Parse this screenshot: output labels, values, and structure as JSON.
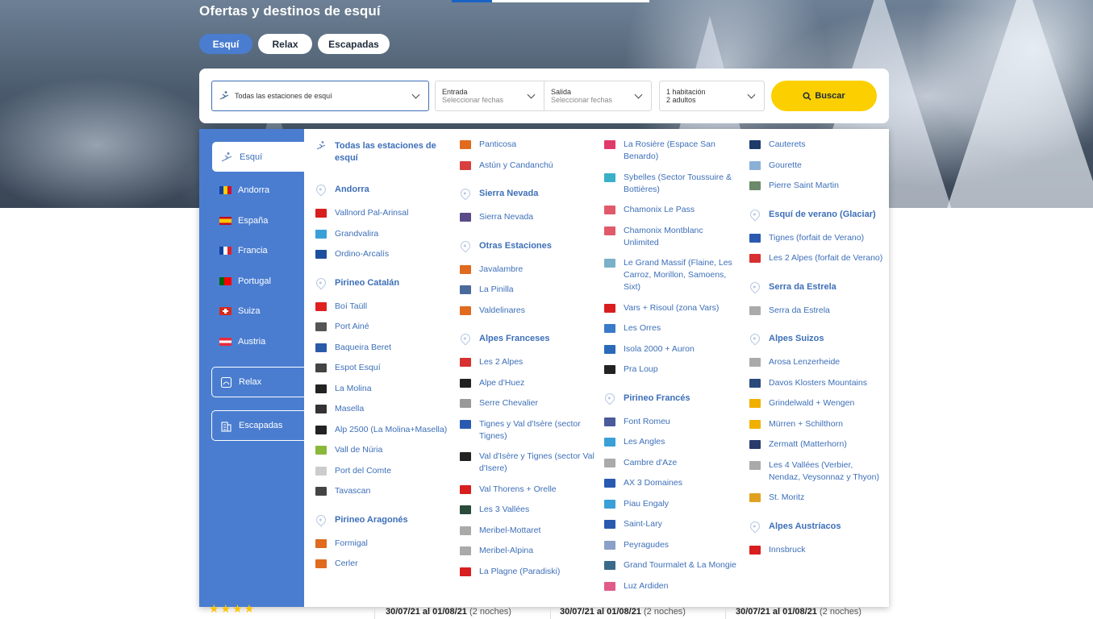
{
  "page": {
    "title": "Ofertas y destinos de esquí"
  },
  "tabs": [
    {
      "label": "Esquí",
      "active": true
    },
    {
      "label": "Relax",
      "active": false
    },
    {
      "label": "Escapadas",
      "active": false
    }
  ],
  "search": {
    "destination": "Todas las estaciones de esquí",
    "checkin_label": "Entrada",
    "checkin_placeholder": "Seleccionar fechas",
    "checkout_label": "Salida",
    "checkout_placeholder": "Seleccionar fechas",
    "rooms": "1 habitación",
    "guests": "2 adultos",
    "button": "Buscar"
  },
  "sidebar": {
    "ski_label": "Esquí",
    "countries": [
      "Andorra",
      "España",
      "Francia",
      "Portugal",
      "Suiza",
      "Austria"
    ],
    "relax_label": "Relax",
    "escapadas_label": "Escapadas"
  },
  "colors": {
    "brand_blue": "#4a7dd0",
    "link_blue": "#3d6fb8",
    "accent_yellow": "#fcd000"
  },
  "columns": [
    {
      "blocks": [
        {
          "type": "head",
          "label": "Todas las estaciones de esquí",
          "icon": "skier-icon"
        },
        {
          "type": "head",
          "label": "Andorra"
        },
        {
          "type": "item",
          "label": "Vallnord Pal-Arinsal",
          "color": "#d81e1e"
        },
        {
          "type": "item",
          "label": "Grandvalira",
          "color": "#3aa0d8"
        },
        {
          "type": "item",
          "label": "Ordino-Arcalís",
          "color": "#1d4fa0"
        },
        {
          "type": "head",
          "label": "Pirineo Catalán"
        },
        {
          "type": "item",
          "label": "Boí Taüll",
          "color": "#e02020"
        },
        {
          "type": "item",
          "label": "Port Ainé",
          "color": "#555555"
        },
        {
          "type": "item",
          "label": "Baqueira Beret",
          "color": "#2a5aa8"
        },
        {
          "type": "item",
          "label": "Espot Esquí",
          "color": "#444444"
        },
        {
          "type": "item",
          "label": "La Molina",
          "color": "#222222"
        },
        {
          "type": "item",
          "label": "Masella",
          "color": "#333333"
        },
        {
          "type": "item",
          "label": "Alp 2500 (La Molina+Masella)",
          "color": "#222222"
        },
        {
          "type": "item",
          "label": "Vall de Núria",
          "color": "#8ab83a"
        },
        {
          "type": "item",
          "label": "Port del Comte",
          "color": "#cccccc"
        },
        {
          "type": "item",
          "label": "Tavascan",
          "color": "#444444"
        },
        {
          "type": "head",
          "label": "Pirineo Aragonés"
        },
        {
          "type": "item",
          "label": "Formigal",
          "color": "#e06a1e"
        },
        {
          "type": "item",
          "label": "Cerler",
          "color": "#e06a1e"
        }
      ]
    },
    {
      "blocks": [
        {
          "type": "item",
          "label": "Panticosa",
          "color": "#e06a1e"
        },
        {
          "type": "item",
          "label": "Astún y Candanchú",
          "color": "#d84040"
        },
        {
          "type": "head",
          "label": "Sierra Nevada"
        },
        {
          "type": "item",
          "label": "Sierra Nevada",
          "color": "#5a4a8a"
        },
        {
          "type": "head",
          "label": "Otras Estaciones"
        },
        {
          "type": "item",
          "label": "Javalambre",
          "color": "#e06a1e"
        },
        {
          "type": "item",
          "label": "La Pinilla",
          "color": "#4a6a9a"
        },
        {
          "type": "item",
          "label": "Valdelinares",
          "color": "#e06a1e"
        },
        {
          "type": "head",
          "label": "Alpes Franceses"
        },
        {
          "type": "item",
          "label": "Les 2 Alpes",
          "color": "#d83030"
        },
        {
          "type": "item",
          "label": "Alpe d'Huez",
          "color": "#222222"
        },
        {
          "type": "item",
          "label": "Serre Chevalier",
          "color": "#999999"
        },
        {
          "type": "item",
          "label": "Tignes y Val d'Isère (sector Tignes)",
          "color": "#2a5ab0"
        },
        {
          "type": "item",
          "label": "Val d'Isère y Tignes (sector Val d'Isere)",
          "color": "#222222"
        },
        {
          "type": "item",
          "label": "Val Thorens + Orelle",
          "color": "#d81e1e"
        },
        {
          "type": "item",
          "label": "Les 3 Vallées",
          "color": "#2a4a3a"
        },
        {
          "type": "item",
          "label": "Meribel-Mottaret",
          "color": "#aaaaaa"
        },
        {
          "type": "item",
          "label": "Meribel-Alpina",
          "color": "#aaaaaa"
        },
        {
          "type": "item",
          "label": "La Plagne (Paradiski)",
          "color": "#d81e1e"
        }
      ]
    },
    {
      "blocks": [
        {
          "type": "item",
          "label": "La Rosière (Espace San Benardo)",
          "color": "#e03a6a"
        },
        {
          "type": "item",
          "label": "Sybelles (Sector Toussuire & Bottières)",
          "color": "#3ab0c8"
        },
        {
          "type": "item",
          "label": "Chamonix Le Pass",
          "color": "#e05a6a"
        },
        {
          "type": "item",
          "label": "Chamonix Montblanc Unlimited",
          "color": "#e05a6a"
        },
        {
          "type": "item",
          "label": "Le Grand Massif (Flaine, Les Carroz, Morillon, Samoens, Sixt)",
          "color": "#7ab0c8"
        },
        {
          "type": "item",
          "label": "Vars + Risoul (zona Vars)",
          "color": "#d81e1e"
        },
        {
          "type": "item",
          "label": "Les Orres",
          "color": "#3a7ac8"
        },
        {
          "type": "item",
          "label": "Isola 2000 + Auron",
          "color": "#2a6ab8"
        },
        {
          "type": "item",
          "label": "Pra Loup",
          "color": "#222222"
        },
        {
          "type": "head",
          "label": "Pirineo Francés"
        },
        {
          "type": "item",
          "label": "Font Romeu",
          "color": "#4a5a9a"
        },
        {
          "type": "item",
          "label": "Les Angles",
          "color": "#3aa0d8"
        },
        {
          "type": "item",
          "label": "Cambre d'Aze",
          "color": "#aaaaaa"
        },
        {
          "type": "item",
          "label": "AX 3 Domaines",
          "color": "#2a5ab0"
        },
        {
          "type": "item",
          "label": "Piau Engaly",
          "color": "#3aa0d8"
        },
        {
          "type": "item",
          "label": "Saint-Lary",
          "color": "#2a5ab0"
        },
        {
          "type": "item",
          "label": "Peyragudes",
          "color": "#8aa0c8"
        },
        {
          "type": "item",
          "label": "Grand Tourmalet & La Mongie",
          "color": "#3a6a8a"
        },
        {
          "type": "item",
          "label": "Luz Ardiden",
          "color": "#e05a8a"
        }
      ]
    },
    {
      "blocks": [
        {
          "type": "item",
          "label": "Cauterets",
          "color": "#1d3a6a"
        },
        {
          "type": "item",
          "label": "Gourette",
          "color": "#8ab0d8"
        },
        {
          "type": "item",
          "label": "Pierre Saint Martin",
          "color": "#6a8a6a"
        },
        {
          "type": "head",
          "label": "Esquí de verano (Glaciar)"
        },
        {
          "type": "item",
          "label": "Tignes (forfait de Verano)",
          "color": "#2a5ab0"
        },
        {
          "type": "item",
          "label": "Les 2 Alpes (forfait de Verano)",
          "color": "#d83030"
        },
        {
          "type": "head",
          "label": "Serra da Estrela"
        },
        {
          "type": "item",
          "label": "Serra da Estrela",
          "color": "#aaaaaa"
        },
        {
          "type": "head",
          "label": "Alpes Suizos"
        },
        {
          "type": "item",
          "label": "Arosa Lenzerheide",
          "color": "#aaaaaa"
        },
        {
          "type": "item",
          "label": "Davos Klosters Mountains",
          "color": "#2a4a7a"
        },
        {
          "type": "item",
          "label": "Grindelwald + Wengen",
          "color": "#f0b000"
        },
        {
          "type": "item",
          "label": "Mürren + Schilthorn",
          "color": "#f0b000"
        },
        {
          "type": "item",
          "label": "Zermatt (Matterhorn)",
          "color": "#2a3a6a"
        },
        {
          "type": "item",
          "label": "Les 4 Vallées (Verbier, Nendaz, Veysonnaz y Thyon)",
          "color": "#aaaaaa"
        },
        {
          "type": "item",
          "label": "St. Moritz",
          "color": "#e0a020"
        },
        {
          "type": "head",
          "label": "Alpes Austríacos"
        },
        {
          "type": "item",
          "label": "Innsbruck",
          "color": "#d81e1e"
        }
      ]
    }
  ],
  "below": {
    "stars": "★★★★",
    "dates": [
      {
        "range": "30/07/21 al 01/08/21",
        "nights": "(2 noches)"
      },
      {
        "range": "30/07/21 al 01/08/21",
        "nights": "(2 noches)"
      },
      {
        "range": "30/07/21 al 01/08/21",
        "nights": "(2 noches)"
      }
    ]
  }
}
